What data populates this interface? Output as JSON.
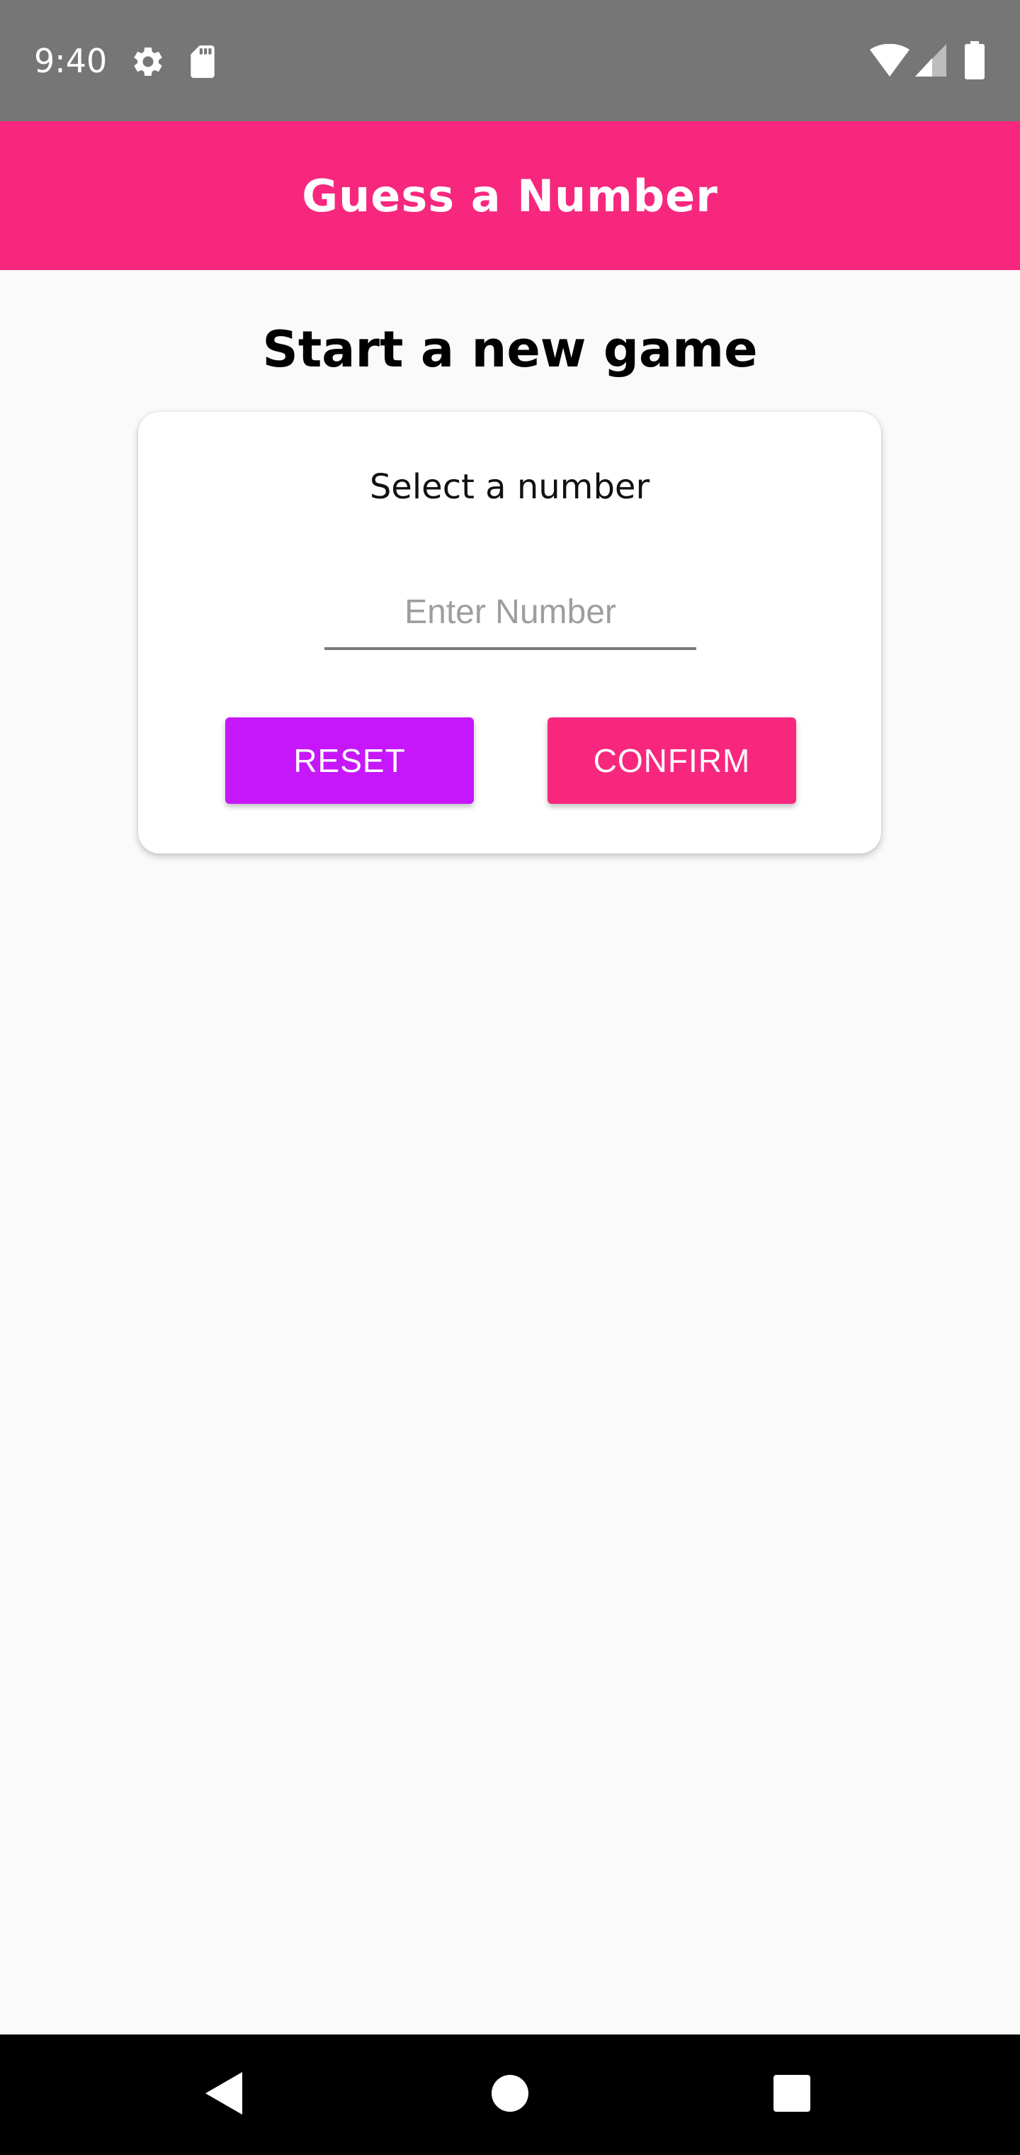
{
  "status_bar": {
    "time": "9:40",
    "icons": [
      "gear-icon",
      "sd-card-icon",
      "wifi-icon",
      "signal-icon",
      "battery-icon"
    ]
  },
  "app_bar": {
    "title": "Guess a Number",
    "color": "#f8277e"
  },
  "main": {
    "title": "Start a new game",
    "card": {
      "label": "Select a number",
      "input": {
        "placeholder": "Enter Number",
        "value": ""
      },
      "buttons": {
        "reset_label": "RESET",
        "reset_color": "#c617fb",
        "confirm_label": "CONFIRM",
        "confirm_color": "#f8277e"
      }
    }
  },
  "nav_bar": {
    "icons": [
      "back-icon",
      "home-icon",
      "recents-icon"
    ]
  }
}
